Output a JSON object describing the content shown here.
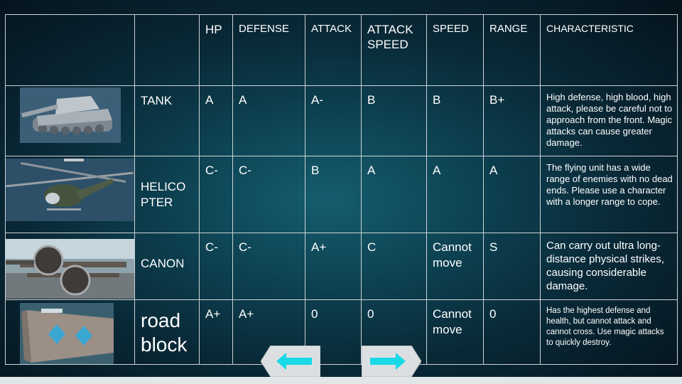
{
  "headers": {
    "hp": "HP",
    "defense": "DEFENSE",
    "attack": "ATTACK",
    "attack_speed": "ATTACK SPEED",
    "speed": "SPEED",
    "range": "RANGE",
    "characteristic": "CHARACTERISTIC"
  },
  "units": [
    {
      "name": "TANK",
      "image": "tank-image",
      "hp": "A",
      "defense": "A",
      "attack": "A-",
      "attack_speed": "B",
      "speed": "B",
      "range": "B+",
      "characteristic": "High defense, high blood, high attack, please be careful not to approach from the front. Magic attacks can cause greater damage."
    },
    {
      "name": "HELICO PTER",
      "image": "helicopter-image",
      "hp": "C-",
      "defense": "C-",
      "attack": "B",
      "attack_speed": "A",
      "speed": "A",
      "range": "A",
      "characteristic": "The flying unit has a wide range of enemies with no dead ends. Please use a character with a longer range to cope."
    },
    {
      "name": "CANON",
      "image": "cannon-image",
      "hp": "C-",
      "defense": "C-",
      "attack": "A+",
      "attack_speed": "C",
      "speed": "Cannot move",
      "range": "S",
      "characteristic": "Can carry out ultra long-distance physical strikes, causing considerable damage."
    },
    {
      "name": "road block",
      "image": "roadblock-image",
      "hp": "A+",
      "defense": "A+",
      "attack": "0",
      "attack_speed": "0",
      "speed": "Cannot move",
      "range": "0",
      "characteristic": "Has the highest defense and health, but cannot attack and cannot cross. Use magic attacks to quickly destroy."
    }
  ],
  "nav": {
    "prev_icon": "arrow-left-icon",
    "next_icon": "arrow-right-icon",
    "button_color": "#dcdfe1",
    "arrow_color": "#19d9e6"
  }
}
